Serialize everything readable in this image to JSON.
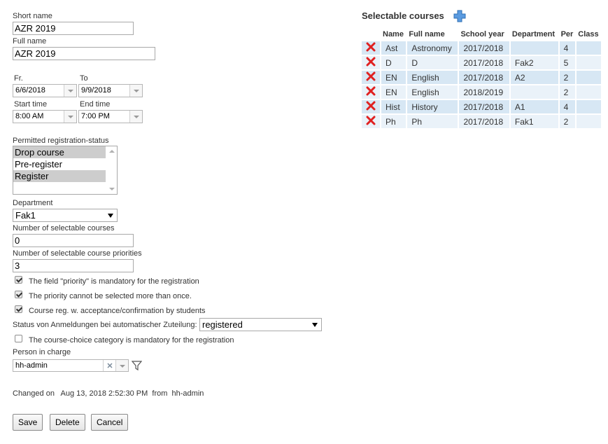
{
  "form": {
    "short_name": {
      "label": "Short name",
      "value": "AZR 2019"
    },
    "full_name": {
      "label": "Full name",
      "value": "AZR 2019"
    },
    "from": {
      "label": "Fr.",
      "value": "6/6/2018"
    },
    "to": {
      "label": "To",
      "value": "9/9/2018"
    },
    "start_time": {
      "label": "Start time",
      "value": "8:00 AM"
    },
    "end_time": {
      "label": "End time",
      "value": "7:00 PM"
    },
    "registration_status": {
      "label": "Permitted registration-status",
      "options": [
        {
          "label": "Drop course",
          "selected": true
        },
        {
          "label": "Pre-register",
          "selected": false
        },
        {
          "label": "Register",
          "selected": true
        }
      ]
    },
    "department": {
      "label": "Department",
      "value": "Fak1"
    },
    "num_selectable_courses": {
      "label": "Number of selectable courses",
      "value": "0"
    },
    "num_priorities": {
      "label": "Number of selectable course priorities",
      "value": "3"
    },
    "checkboxes": [
      {
        "label": "The field \"priority\" is mandatory for the registration",
        "checked": true
      },
      {
        "label": "The priority cannot be selected more than once.",
        "checked": true
      },
      {
        "label": "Course reg. w. acceptance/confirmation by students",
        "checked": true
      }
    ],
    "auto_status": {
      "label": "Status von Anmeldungen bei automatischer Zuteilung:",
      "value": "registered"
    },
    "category_mandatory": {
      "label": "The course-choice category is mandatory for the registration",
      "checked": false
    },
    "person_in_charge": {
      "label": "Person in charge",
      "value": "hh-admin"
    }
  },
  "changed": {
    "label": "Changed on",
    "timestamp": "Aug 13, 2018 2:52:30 PM",
    "from_label": "from",
    "user": "hh-admin"
  },
  "buttons": {
    "save": "Save",
    "delete": "Delete",
    "cancel": "Cancel"
  },
  "courses": {
    "title": "Selectable courses",
    "headers": [
      "Name",
      "Full name",
      "School year",
      "Department",
      "Per",
      "Class"
    ],
    "rows": [
      {
        "name": "Ast",
        "full_name": "Astronomy",
        "school_year": "2017/2018",
        "department": "",
        "per": "4",
        "class": ""
      },
      {
        "name": "D",
        "full_name": "D",
        "school_year": "2017/2018",
        "department": "Fak2",
        "per": "5",
        "class": ""
      },
      {
        "name": "EN",
        "full_name": "English",
        "school_year": "2017/2018",
        "department": "A2",
        "per": "2",
        "class": ""
      },
      {
        "name": "EN",
        "full_name": "English",
        "school_year": "2018/2019",
        "department": "",
        "per": "2",
        "class": ""
      },
      {
        "name": "Hist",
        "full_name": "History",
        "school_year": "2017/2018",
        "department": "A1",
        "per": "4",
        "class": ""
      },
      {
        "name": "Ph",
        "full_name": "Ph",
        "school_year": "2017/2018",
        "department": "Fak1",
        "per": "2",
        "class": ""
      }
    ]
  },
  "colors": {
    "delete_icon": "#e02020",
    "add_icon": "#4a90d9",
    "row_odd": "#d7e7f4",
    "row_even": "#eaf2f9"
  }
}
